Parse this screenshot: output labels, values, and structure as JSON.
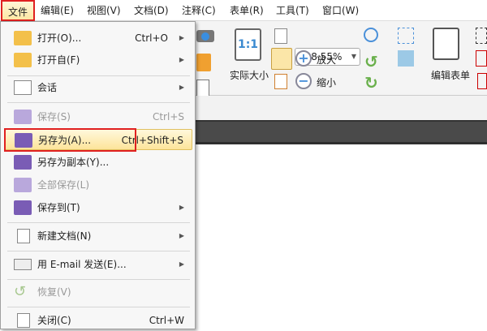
{
  "menubar": [
    "文件",
    "编辑(E)",
    "视图(V)",
    "文档(D)",
    "注释(C)",
    "表单(R)",
    "工具(T)",
    "窗口(W)"
  ],
  "toolbar": {
    "actual_size": "实际大小",
    "actual_size_icon": "1:1",
    "zoom_value": "118.55%",
    "zoom_in": "放大",
    "zoom_out": "缩小",
    "edit_form": "编辑表单"
  },
  "menu": [
    {
      "label": "打开(O)...",
      "shortcut": "Ctrl+O",
      "icon": "folder-icon"
    },
    {
      "label": "打开自(F)",
      "icon": "folder-globe-icon"
    },
    {
      "label": "会话",
      "icon": "session-icon"
    },
    {
      "label": "保存(S)",
      "shortcut": "Ctrl+S",
      "icon": "save-icon",
      "disabled": true
    },
    {
      "label": "另存为(A)...",
      "shortcut": "Ctrl+Shift+S",
      "icon": "save-as-icon",
      "highlighted": true
    },
    {
      "label": "另存为副本(Y)...",
      "icon": "save-copy-icon"
    },
    {
      "label": "全部保存(L)",
      "icon": "save-all-icon",
      "disabled": true
    },
    {
      "label": "保存到(T)",
      "icon": "save-to-icon"
    },
    {
      "label": "新建文档(N)",
      "icon": "new-document-icon"
    },
    {
      "label": "用 E-mail 发送(E)...",
      "icon": "email-icon"
    },
    {
      "label": "恢复(V)",
      "icon": "revert-icon",
      "disabled": true
    },
    {
      "label": "关闭(C)",
      "shortcut": "Ctrl+W",
      "icon": "close-document-icon"
    }
  ]
}
